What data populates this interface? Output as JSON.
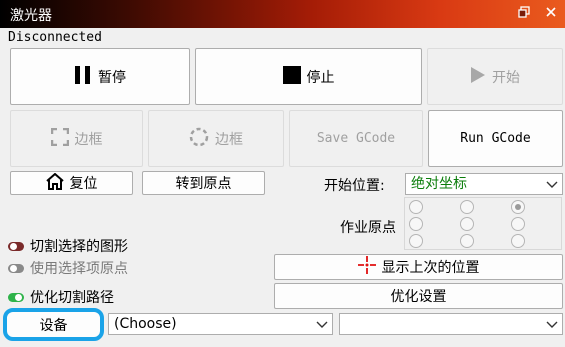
{
  "window": {
    "title": "激光器",
    "restore_icon": "restore-icon",
    "close_icon": "close-icon"
  },
  "status": "Disconnected",
  "row1": {
    "pause_label": "暂停",
    "stop_label": "停止",
    "start_label": "开始"
  },
  "row2": {
    "frame_label": "边框",
    "frame_circle_label": "边框",
    "save_gcode_label": "Save GCode",
    "run_gcode_label": "Run GCode"
  },
  "row3": {
    "home_label": "复位",
    "goto_origin_label": "转到原点",
    "start_position_label": "开始位置:",
    "start_position_value": "绝对坐标"
  },
  "origin": {
    "label": "作业原点",
    "selected_index": 2
  },
  "options": {
    "cut_selected": "切割选择的图形",
    "use_selection_origin": "使用选择项原点",
    "optimize_path": "优化切割路径"
  },
  "buttons": {
    "show_last_position": "显示上次的位置",
    "optimize_settings": "优化设置",
    "device": "设备"
  },
  "device_select": {
    "value": "(Choose)"
  },
  "second_select": {
    "value": ""
  },
  "colors": {
    "accent_highlight": "#1aa3e8",
    "combo_text_green": "#0a7d0a",
    "toggle_on": "#2fb34a",
    "toggle_cut": "#7a2a2a",
    "crosshair_red": "#e01010"
  }
}
